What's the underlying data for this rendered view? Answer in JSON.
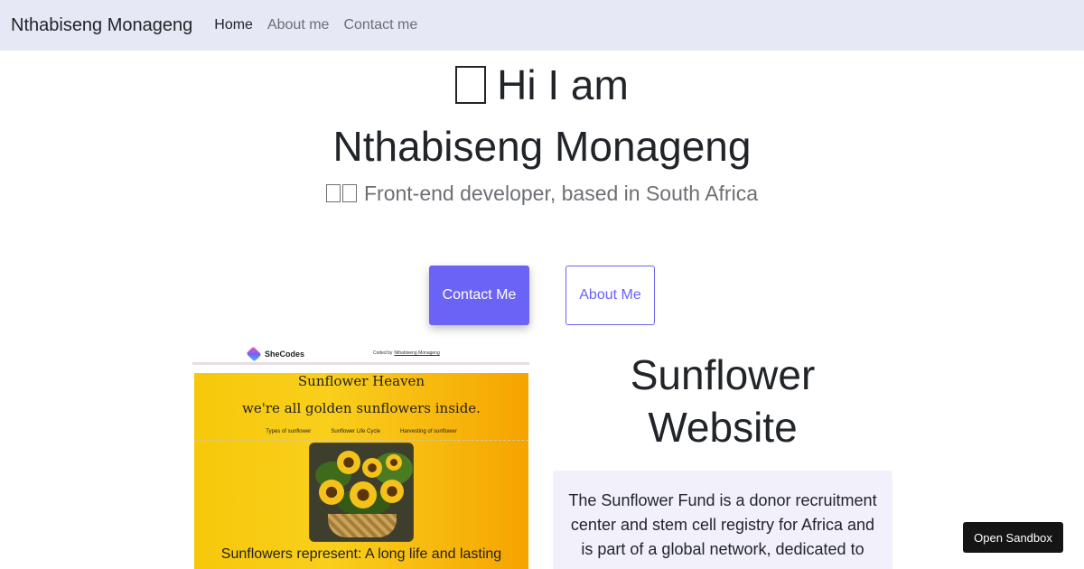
{
  "nav": {
    "brand": "Nthabiseng Monageng",
    "links": [
      {
        "label": "Home"
      },
      {
        "label": "About me"
      },
      {
        "label": "Contact me"
      }
    ]
  },
  "hero": {
    "greeting": "Hi I am",
    "name": "Nthabiseng Monageng",
    "subtitle": "Front-end developer, based in South Africa"
  },
  "buttons": {
    "contact": "Contact Me",
    "about": "About Me"
  },
  "project": {
    "preview": {
      "logo_text": "SheCodes",
      "coded_by_prefix": "Coded by",
      "coded_by_name": "Nthabiseng Monageng",
      "site_title": "Sunflower Heaven",
      "tagline": "we're all golden sunflowers inside.",
      "nav": [
        "Types of sunflower",
        "Sunflower Life Cycle",
        "Harvesting of sunflower"
      ],
      "bottom_text": "Sunflowers represent: A long life and lasting"
    },
    "title": "Sunflower Website",
    "description": "The Sunflower Fund is a donor recruitment center and stem cell registry for Africa and is part of a global network, dedicated to"
  },
  "sandbox": {
    "label": "Open Sandbox"
  },
  "colors": {
    "accent": "#6a63f5",
    "navbar_bg": "#e6e8f5",
    "card_bg": "#f2f1fb"
  }
}
